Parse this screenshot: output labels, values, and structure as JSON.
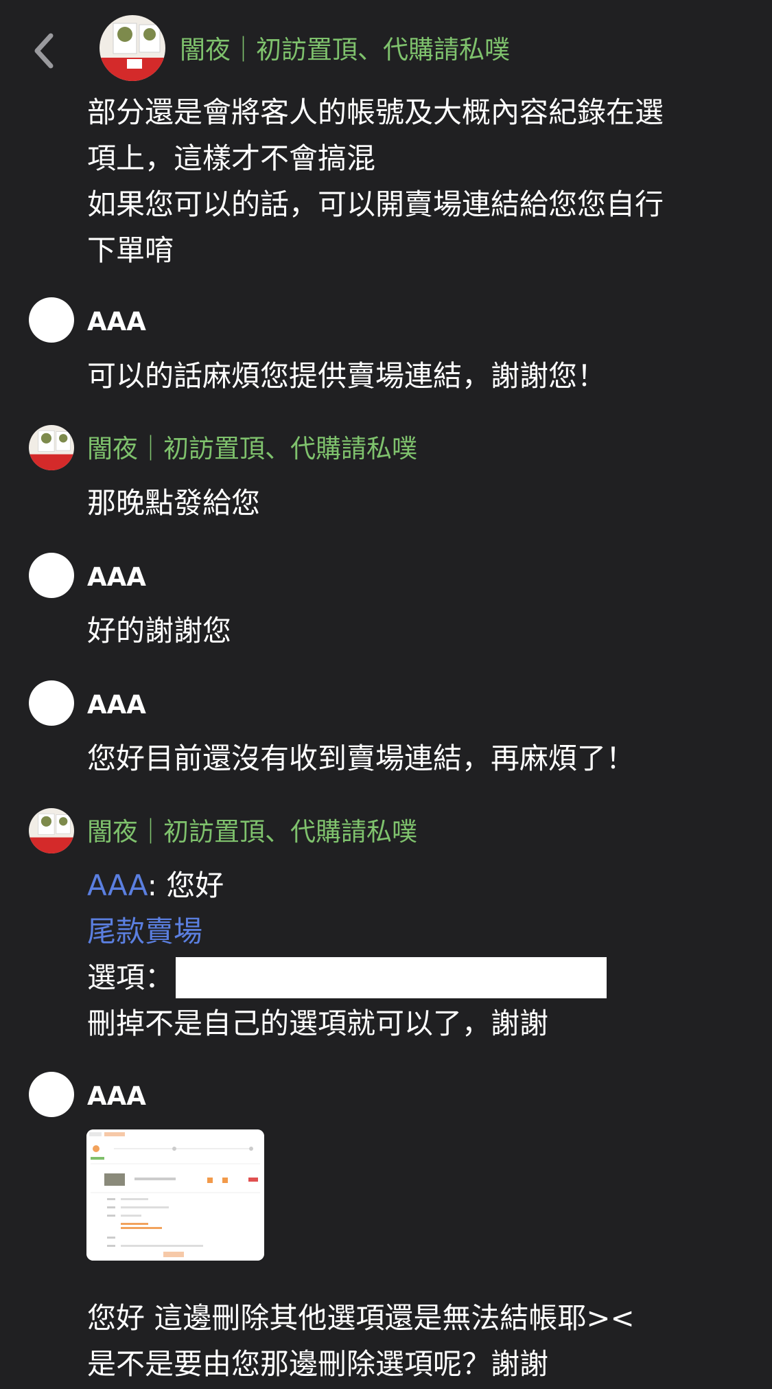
{
  "header": {
    "back_icon": "chevron-left-icon",
    "shop_name": "闇夜｜初訪置頂、代購請私噗"
  },
  "messages": [
    {
      "sender": "shop",
      "lines": [
        "部分還是會將客人的帳號及大概內容紀錄在選",
        "項上，這樣才不會搞混",
        "如果您可以的話，可以開賣場連結給您您自行",
        "下單唷"
      ]
    },
    {
      "sender": "AAA",
      "lines": [
        "可以的話麻煩您提供賣場連結，謝謝您！"
      ]
    },
    {
      "sender": "闇夜｜初訪置頂、代購請私噗",
      "lines": [
        "那晚點發給您"
      ]
    },
    {
      "sender": "AAA",
      "lines": [
        "好的謝謝您"
      ]
    },
    {
      "sender": "AAA",
      "lines": [
        "您好目前還沒有收到賣場連結，再麻煩了！"
      ]
    },
    {
      "sender": "闇夜｜初訪置頂、代購請私噗",
      "mention": "AAA",
      "greeting": ": 您好",
      "link_text": "尾款賣場",
      "option_label": "選項：",
      "last_line": "刪掉不是自己的選項就可以了，謝謝"
    },
    {
      "sender": "AAA",
      "image": "order-screenshot-thumbnail",
      "lines": [
        "您好 這邊刪除其他選項還是無法結帳耶><",
        "是不是要由您那邊刪除選項呢？謝謝"
      ]
    }
  ],
  "colors": {
    "background": "#202022",
    "shop_name": "#7fc26d",
    "link": "#5b7fe0",
    "text": "#ffffff"
  }
}
